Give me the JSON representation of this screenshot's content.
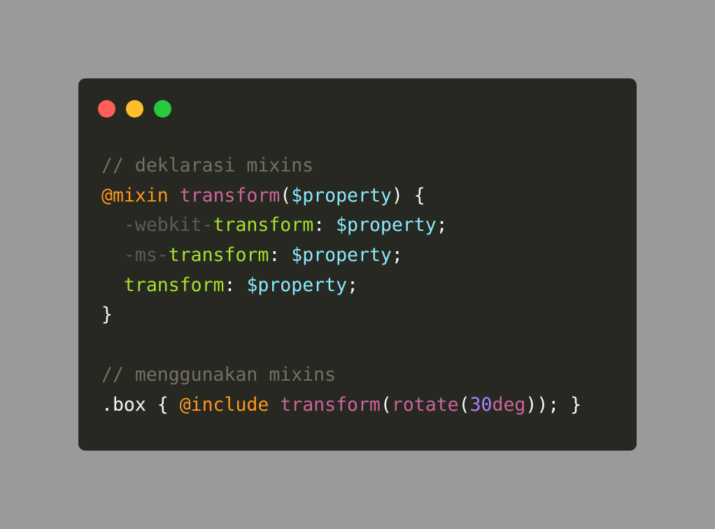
{
  "window": {
    "controls": [
      {
        "name": "close",
        "color": "#ff5f56"
      },
      {
        "name": "minimize",
        "color": "#ffbd2e"
      },
      {
        "name": "maximize",
        "color": "#27c93f"
      }
    ]
  },
  "code": {
    "lines": [
      [
        {
          "t": "// deklarasi mixins",
          "c": "comment"
        }
      ],
      [
        {
          "t": "@mixin",
          "c": "at"
        },
        {
          "t": " ",
          "c": "plain"
        },
        {
          "t": "transform",
          "c": "fn"
        },
        {
          "t": "(",
          "c": "plain"
        },
        {
          "t": "$property",
          "c": "var"
        },
        {
          "t": ") {",
          "c": "plain"
        }
      ],
      [
        {
          "t": "  ",
          "c": "plain"
        },
        {
          "t": "-webkit-",
          "c": "prefix"
        },
        {
          "t": "transform",
          "c": "prop"
        },
        {
          "t": ": ",
          "c": "plain"
        },
        {
          "t": "$property",
          "c": "var"
        },
        {
          "t": ";",
          "c": "plain"
        }
      ],
      [
        {
          "t": "  ",
          "c": "plain"
        },
        {
          "t": "-ms-",
          "c": "prefix"
        },
        {
          "t": "transform",
          "c": "prop"
        },
        {
          "t": ": ",
          "c": "plain"
        },
        {
          "t": "$property",
          "c": "var"
        },
        {
          "t": ";",
          "c": "plain"
        }
      ],
      [
        {
          "t": "  ",
          "c": "plain"
        },
        {
          "t": "transform",
          "c": "prop"
        },
        {
          "t": ": ",
          "c": "plain"
        },
        {
          "t": "$property",
          "c": "var"
        },
        {
          "t": ";",
          "c": "plain"
        }
      ],
      [
        {
          "t": "}",
          "c": "plain"
        }
      ],
      [],
      [
        {
          "t": "// menggunakan mixins",
          "c": "comment"
        }
      ],
      [
        {
          "t": ".box { ",
          "c": "plain"
        },
        {
          "t": "@include",
          "c": "at"
        },
        {
          "t": " ",
          "c": "plain"
        },
        {
          "t": "transform",
          "c": "fn"
        },
        {
          "t": "(",
          "c": "plain"
        },
        {
          "t": "rotate",
          "c": "fn"
        },
        {
          "t": "(",
          "c": "plain"
        },
        {
          "t": "30",
          "c": "num"
        },
        {
          "t": "deg",
          "c": "fn"
        },
        {
          "t": ")); }",
          "c": "plain"
        }
      ]
    ]
  }
}
